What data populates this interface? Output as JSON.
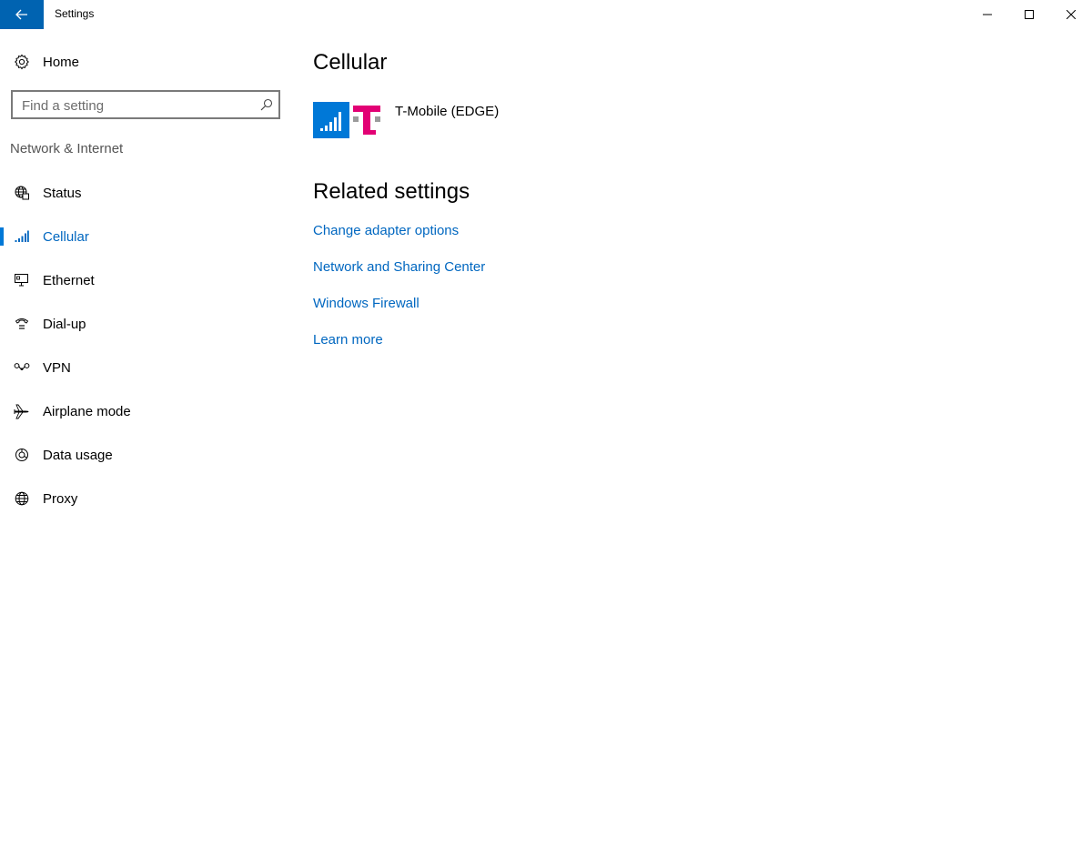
{
  "window": {
    "title": "Settings",
    "controls": [
      "minimize",
      "maximize",
      "close"
    ]
  },
  "sidebar": {
    "home_label": "Home",
    "search_placeholder": "Find a setting",
    "section_label": "Network & Internet",
    "items": [
      {
        "label": "Status",
        "icon": "globe-status-icon",
        "active": false
      },
      {
        "label": "Cellular",
        "icon": "signal-bars-icon",
        "active": true
      },
      {
        "label": "Ethernet",
        "icon": "ethernet-monitor-icon",
        "active": false
      },
      {
        "label": "Dial-up",
        "icon": "dialup-phone-icon",
        "active": false
      },
      {
        "label": "VPN",
        "icon": "vpn-icon",
        "active": false
      },
      {
        "label": "Airplane mode",
        "icon": "airplane-icon",
        "active": false
      },
      {
        "label": "Data usage",
        "icon": "pie-chart-icon",
        "active": false
      },
      {
        "label": "Proxy",
        "icon": "globe-icon",
        "active": false
      }
    ]
  },
  "main": {
    "title": "Cellular",
    "carrier": {
      "name": "T-Mobile (EDGE)",
      "logo": "T"
    },
    "related_title": "Related settings",
    "links": [
      "Change adapter options",
      "Network and Sharing Center",
      "Windows Firewall",
      "Learn more"
    ]
  },
  "colors": {
    "accent": "#0078d7",
    "title_button": "#0063b1",
    "link": "#0067c0",
    "tmobile_magenta": "#e20074"
  }
}
